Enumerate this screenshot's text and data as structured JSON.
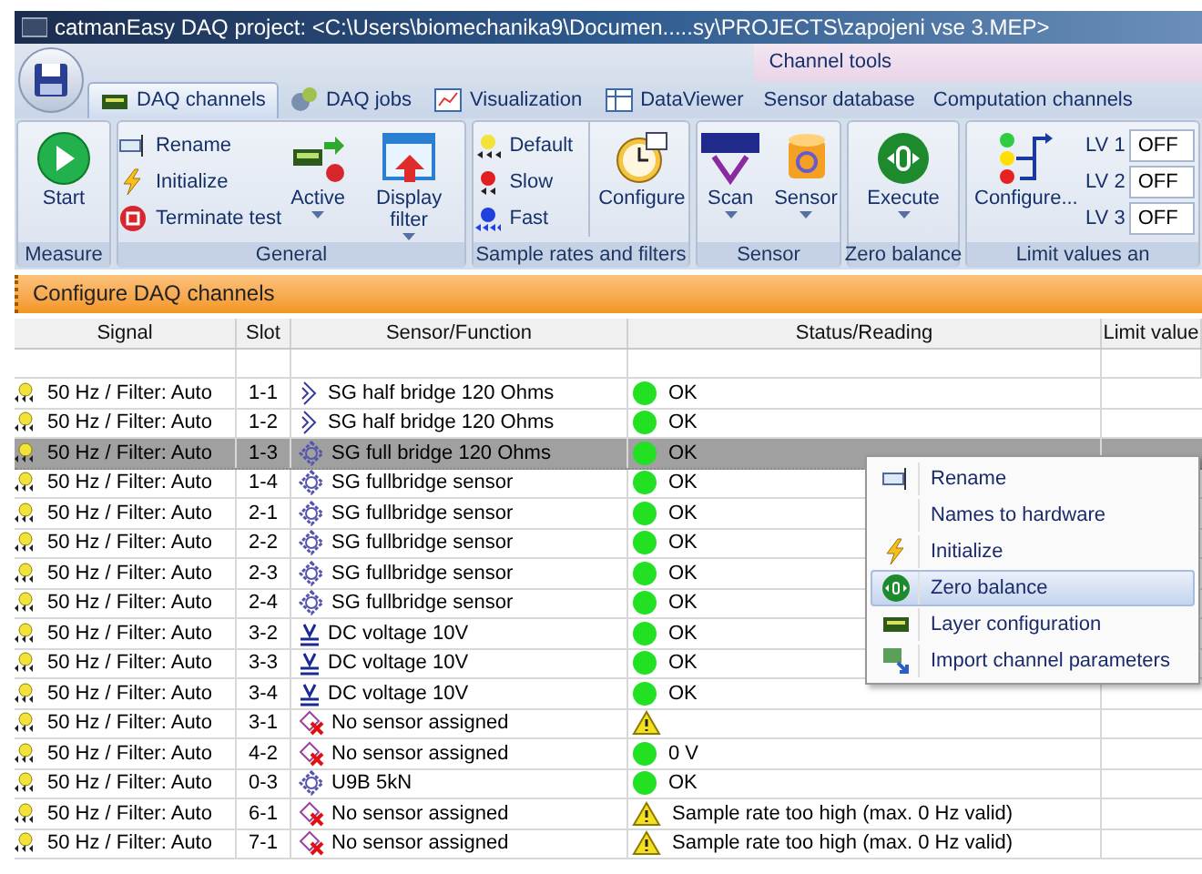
{
  "window": {
    "title": "catmanEasy DAQ project: <C:\\Users\\biomechanika9\\Documen.....sy\\PROJECTS\\zapojeni vse 3.MEP>"
  },
  "context_tab_label": "Channel tools",
  "tabs": [
    {
      "label": "DAQ channels",
      "selected": true
    },
    {
      "label": "DAQ jobs",
      "selected": false
    },
    {
      "label": "Visualization",
      "selected": false
    },
    {
      "label": "DataViewer",
      "selected": false
    },
    {
      "label": "Sensor database",
      "selected": false
    },
    {
      "label": "Computation channels",
      "selected": false
    }
  ],
  "ribbon_groups": [
    {
      "label": "Measure",
      "items": [
        {
          "kind": "large",
          "label": "Start",
          "menu": false
        }
      ]
    },
    {
      "label": "General",
      "items": [
        {
          "kind": "small",
          "label": "Rename"
        },
        {
          "kind": "small",
          "label": "Initialize"
        },
        {
          "kind": "small",
          "label": "Terminate test"
        },
        {
          "kind": "large",
          "label": "Active",
          "menu": true
        },
        {
          "kind": "large",
          "label": "Display filter",
          "menu": true
        }
      ]
    },
    {
      "label": "Sample rates and filters",
      "items": [
        {
          "kind": "small",
          "label": "Default"
        },
        {
          "kind": "small",
          "label": "Slow"
        },
        {
          "kind": "small",
          "label": "Fast"
        },
        {
          "kind": "large",
          "label": "Configure",
          "menu": false
        }
      ]
    },
    {
      "label": "Sensor",
      "items": [
        {
          "kind": "large",
          "label": "Scan",
          "menu": true
        },
        {
          "kind": "large",
          "label": "Sensor",
          "menu": true
        }
      ]
    },
    {
      "label": "Zero balance",
      "items": [
        {
          "kind": "large",
          "label": "Execute",
          "menu": true
        }
      ]
    },
    {
      "label": "Limit values an",
      "items": [
        {
          "kind": "large",
          "label": "Configure...",
          "menu": false
        },
        {
          "kind": "field",
          "label": "LV 1",
          "value": "OFF"
        },
        {
          "kind": "field",
          "label": "LV 2",
          "value": "OFF"
        },
        {
          "kind": "field",
          "label": "LV 3",
          "value": "OFF"
        }
      ]
    }
  ],
  "panel_title": "Configure DAQ channels",
  "table": {
    "columns": [
      "Signal",
      "Slot",
      "Sensor/Function",
      "Status/Reading",
      "Limit value"
    ],
    "rows": [
      {
        "signal": "50 Hz / Filter: Auto",
        "slot": "1-1",
        "sensor": {
          "kind": "half",
          "text": "SG half bridge 120 Ohms"
        },
        "status": {
          "kind": "ok",
          "text": "OK"
        },
        "selected": false
      },
      {
        "signal": "50 Hz / Filter: Auto",
        "slot": "1-2",
        "sensor": {
          "kind": "half",
          "text": "SG half bridge 120 Ohms"
        },
        "status": {
          "kind": "ok",
          "text": "OK"
        },
        "selected": false
      },
      {
        "signal": "50 Hz / Filter: Auto",
        "slot": "1-3",
        "sensor": {
          "kind": "full",
          "text": "SG full bridge 120 Ohms"
        },
        "status": {
          "kind": "ok",
          "text": "OK"
        },
        "selected": true
      },
      {
        "signal": "50 Hz / Filter: Auto",
        "slot": "1-4",
        "sensor": {
          "kind": "full",
          "text": "SG fullbridge sensor"
        },
        "status": {
          "kind": "ok",
          "text": "OK"
        },
        "selected": false
      },
      {
        "signal": "50 Hz / Filter: Auto",
        "slot": "2-1",
        "sensor": {
          "kind": "full",
          "text": "SG fullbridge sensor"
        },
        "status": {
          "kind": "ok",
          "text": "OK"
        },
        "selected": false
      },
      {
        "signal": "50 Hz / Filter: Auto",
        "slot": "2-2",
        "sensor": {
          "kind": "full",
          "text": "SG fullbridge sensor"
        },
        "status": {
          "kind": "ok",
          "text": "OK"
        },
        "selected": false
      },
      {
        "signal": "50 Hz / Filter: Auto",
        "slot": "2-3",
        "sensor": {
          "kind": "full",
          "text": "SG fullbridge sensor"
        },
        "status": {
          "kind": "ok",
          "text": "OK"
        },
        "selected": false
      },
      {
        "signal": "50 Hz / Filter: Auto",
        "slot": "2-4",
        "sensor": {
          "kind": "full",
          "text": "SG fullbridge sensor"
        },
        "status": {
          "kind": "ok",
          "text": "OK"
        },
        "selected": false
      },
      {
        "signal": "50 Hz / Filter: Auto",
        "slot": "3-2",
        "sensor": {
          "kind": "dc",
          "text": "DC voltage 10V"
        },
        "status": {
          "kind": "ok",
          "text": "OK"
        },
        "selected": false
      },
      {
        "signal": "50 Hz / Filter: Auto",
        "slot": "3-3",
        "sensor": {
          "kind": "dc",
          "text": "DC voltage 10V"
        },
        "status": {
          "kind": "ok",
          "text": "OK"
        },
        "selected": false
      },
      {
        "signal": "50 Hz / Filter: Auto",
        "slot": "3-4",
        "sensor": {
          "kind": "dc",
          "text": "DC voltage 10V"
        },
        "status": {
          "kind": "ok",
          "text": "OK"
        },
        "selected": false
      },
      {
        "signal": "50 Hz / Filter: Auto",
        "slot": "3-1",
        "sensor": {
          "kind": "none",
          "text": "No sensor assigned"
        },
        "status": {
          "kind": "warn"
        },
        "selected": false
      },
      {
        "signal": "50 Hz / Filter: Auto",
        "slot": "4-2",
        "sensor": {
          "kind": "none",
          "text": "No sensor assigned"
        },
        "status": {
          "kind": "ok",
          "text": "0 V"
        },
        "selected": false
      },
      {
        "signal": "50 Hz / Filter: Auto",
        "slot": "0-3",
        "sensor": {
          "kind": "full",
          "text": "U9B 5kN"
        },
        "status": {
          "kind": "ok",
          "text": "OK"
        },
        "selected": false
      },
      {
        "signal": "50 Hz / Filter: Auto",
        "slot": "6-1",
        "sensor": {
          "kind": "none",
          "text": "No sensor assigned"
        },
        "status": {
          "kind": "warn",
          "text": "Sample rate too high (max. 0 Hz valid)"
        },
        "selected": false
      },
      {
        "signal": "50 Hz / Filter: Auto",
        "slot": "7-1",
        "sensor": {
          "kind": "none",
          "text": "No sensor assigned"
        },
        "status": {
          "kind": "warn",
          "text": "Sample rate too high (max. 0 Hz valid)"
        },
        "selected": false
      }
    ]
  },
  "context_menu": [
    {
      "label": "Rename",
      "selected": false
    },
    {
      "label": "Names to hardware",
      "selected": false
    },
    {
      "label": "Initialize",
      "selected": false
    },
    {
      "label": "Zero balance",
      "selected": true
    },
    {
      "label": "Layer configuration",
      "selected": false
    },
    {
      "label": "Import channel parameters",
      "selected": false
    }
  ]
}
